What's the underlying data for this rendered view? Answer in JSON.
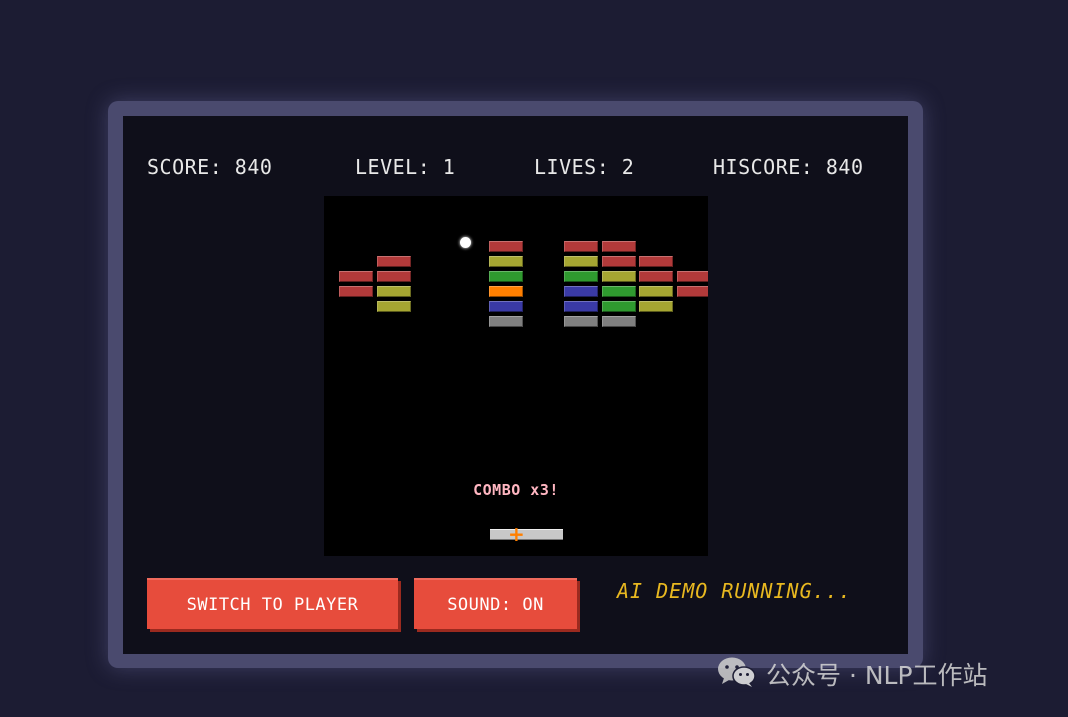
{
  "hud": {
    "score": "SCORE: 840",
    "level": "LEVEL: 1",
    "lives": "LIVES: 2",
    "hiscore": "HISCORE: 840"
  },
  "game": {
    "combo_text": "COMBO x3!",
    "bricks": [
      {
        "col": 1,
        "row": 1,
        "color": "#b23a3a"
      },
      {
        "col": 0,
        "row": 2,
        "color": "#b23a3a"
      },
      {
        "col": 1,
        "row": 2,
        "color": "#b23a3a"
      },
      {
        "col": 0,
        "row": 3,
        "color": "#b23a3a"
      },
      {
        "col": 1,
        "row": 3,
        "color": "#a6a632"
      },
      {
        "col": 1,
        "row": 4,
        "color": "#a6a632"
      },
      {
        "col": 4,
        "row": 0,
        "color": "#b23a3a"
      },
      {
        "col": 4,
        "row": 1,
        "color": "#a6a632"
      },
      {
        "col": 4,
        "row": 2,
        "color": "#2f9a2f"
      },
      {
        "col": 4,
        "row": 3,
        "color": "#ff7f00"
      },
      {
        "col": 4,
        "row": 4,
        "color": "#3a3aa6"
      },
      {
        "col": 4,
        "row": 5,
        "color": "#7f7f7f"
      },
      {
        "col": 6,
        "row": 0,
        "color": "#b23a3a"
      },
      {
        "col": 6,
        "row": 1,
        "color": "#a6a632"
      },
      {
        "col": 6,
        "row": 2,
        "color": "#2f9a2f"
      },
      {
        "col": 6,
        "row": 3,
        "color": "#3a3aa6"
      },
      {
        "col": 6,
        "row": 4,
        "color": "#3a3aa6"
      },
      {
        "col": 6,
        "row": 5,
        "color": "#7f7f7f"
      },
      {
        "col": 7,
        "row": 0,
        "color": "#b23a3a"
      },
      {
        "col": 7,
        "row": 1,
        "color": "#b23a3a"
      },
      {
        "col": 7,
        "row": 2,
        "color": "#a6a632"
      },
      {
        "col": 7,
        "row": 3,
        "color": "#2f9a2f"
      },
      {
        "col": 7,
        "row": 4,
        "color": "#2f9a2f"
      },
      {
        "col": 7,
        "row": 5,
        "color": "#7f7f7f"
      },
      {
        "col": 8,
        "row": 1,
        "color": "#b23a3a"
      },
      {
        "col": 8,
        "row": 2,
        "color": "#b23a3a"
      },
      {
        "col": 8,
        "row": 3,
        "color": "#a6a632"
      },
      {
        "col": 8,
        "row": 4,
        "color": "#a6a632"
      },
      {
        "col": 9,
        "row": 2,
        "color": "#b23a3a"
      },
      {
        "col": 9,
        "row": 3,
        "color": "#b23a3a"
      }
    ],
    "paddle_marker_color": "#ff7f00"
  },
  "controls": {
    "switch_label": "SWITCH TO PLAYER",
    "sound_label": "SOUND: ON",
    "status_text": "AI DEMO RUNNING..."
  },
  "colors": {
    "page_bg": "#1c1c33",
    "frame": "#4a4a6e",
    "screen": "#0f0f1a",
    "button": "#e74c3c",
    "status": "#e8b820",
    "combo": "#ffb6c1"
  },
  "watermark": {
    "icon": "wechat-icon",
    "text": "公众号 · NLP工作站"
  }
}
